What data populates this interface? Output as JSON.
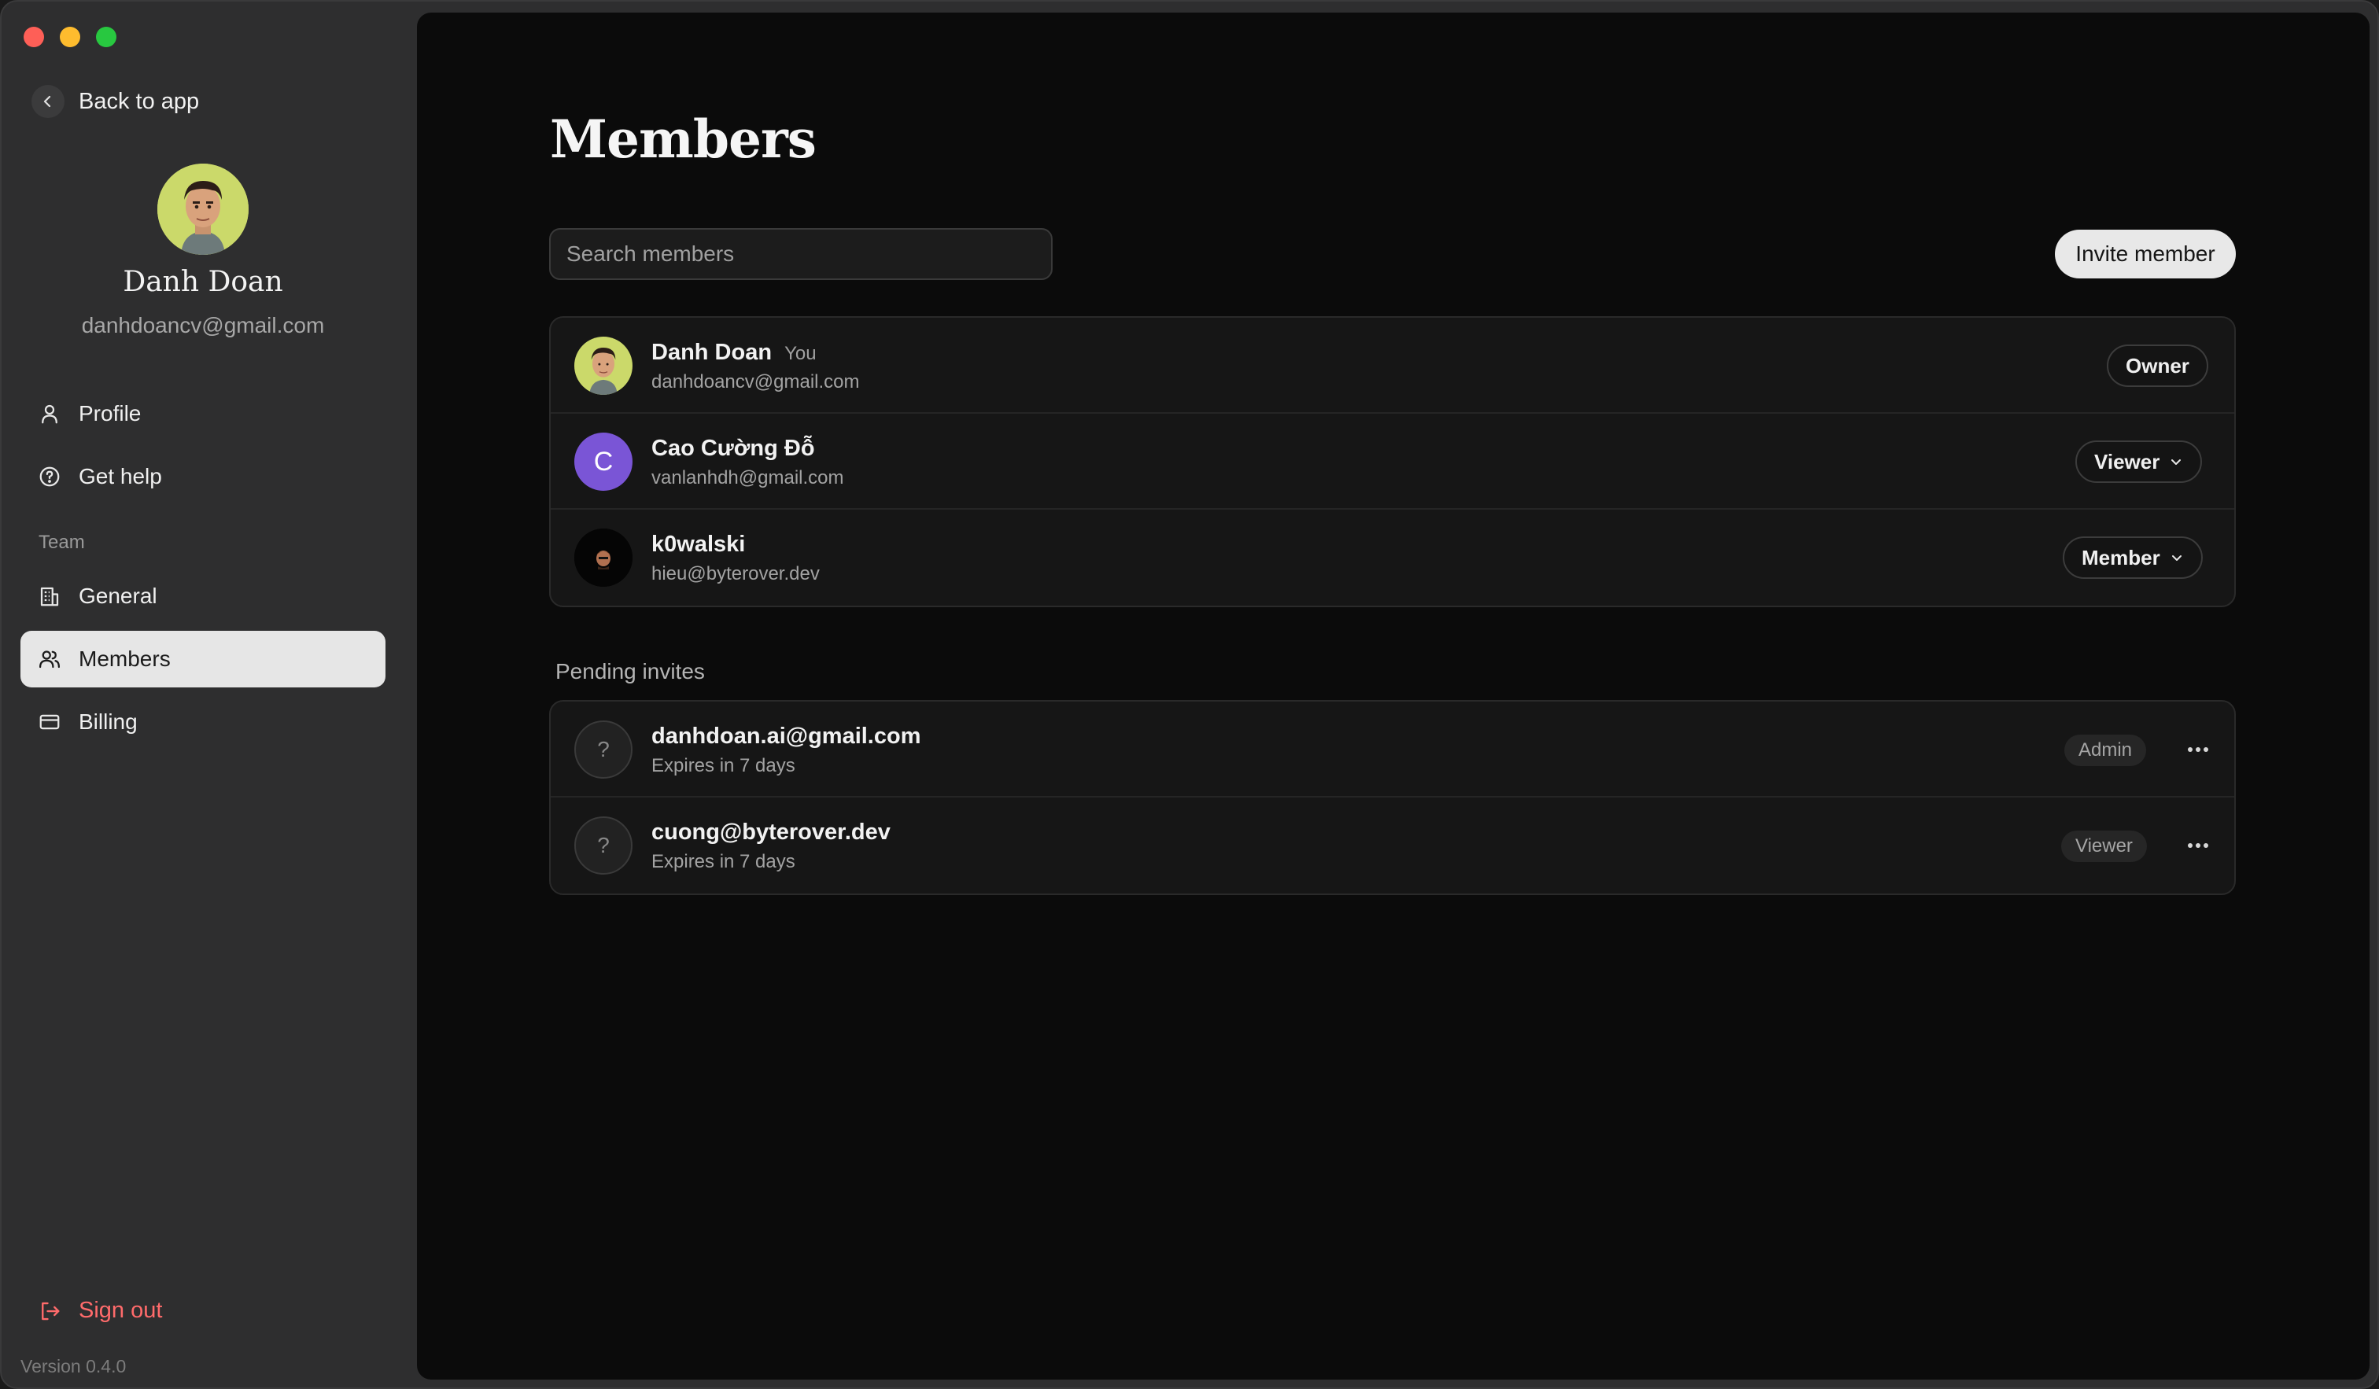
{
  "sidebar": {
    "back_label": "Back to app",
    "user": {
      "name": "Danh Doan",
      "email": "danhdoancv@gmail.com"
    },
    "items": [
      {
        "label": "Profile",
        "icon": "user-icon"
      },
      {
        "label": "Get help",
        "icon": "help-circle-icon"
      }
    ],
    "team_label": "Team",
    "team_items": [
      {
        "label": "General",
        "icon": "building-icon"
      },
      {
        "label": "Members",
        "icon": "users-icon",
        "active": true
      },
      {
        "label": "Billing",
        "icon": "credit-card-icon"
      }
    ],
    "signout_label": "Sign out",
    "version": "Version 0.4.0"
  },
  "main": {
    "title": "Members",
    "search_placeholder": "Search members",
    "invite_label": "Invite member",
    "members": [
      {
        "name": "Danh Doan",
        "tag": "You",
        "email": "danhdoancv@gmail.com",
        "role": "Owner",
        "avatar": "photo"
      },
      {
        "name": "Cao Cường Đỗ",
        "email": "vanlanhdh@gmail.com",
        "role": "Viewer",
        "avatar": "C",
        "avatar_color": "#7a55d6"
      },
      {
        "name": "k0walski",
        "email": "hieu@byterover.dev",
        "role": "Member",
        "avatar": "photo-dark"
      }
    ],
    "pending_label": "Pending invites",
    "pending": [
      {
        "avatar": "?",
        "email": "danhdoan.ai@gmail.com",
        "expires": "Expires in 7 days",
        "role": "Admin"
      },
      {
        "avatar": "?",
        "email": "cuong@byterover.dev",
        "expires": "Expires in 7 days",
        "role": "Viewer"
      }
    ]
  },
  "colors": {
    "accent_danger": "#ff6b6b",
    "active_nav_bg": "#e6e6e6",
    "viewer_avatar": "#7a55d6"
  }
}
